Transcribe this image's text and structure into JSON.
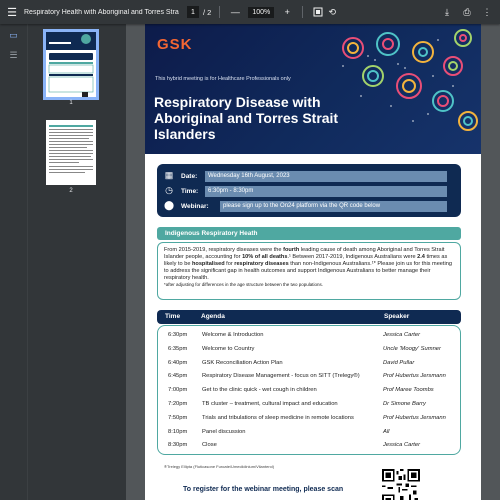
{
  "toolbar": {
    "title": "Respiratory Health with Aboriginal and Torres Strait Islan...",
    "page_current": "1",
    "page_total": "/ 2",
    "zoom_minus": "—",
    "zoom": "100%",
    "zoom_plus": "+",
    "icons": [
      "menu-icon",
      "fit-page-icon",
      "rotate-icon",
      "download-icon",
      "print-icon",
      "more-icon"
    ]
  },
  "sidebar": {
    "thumbnails": [
      {
        "label": "1"
      },
      {
        "label": "2"
      }
    ]
  },
  "document": {
    "logo": "GSK",
    "hcp_note": "This hybrid meeting is for Healthcare Professionals only",
    "title": "Respiratory Disease with Aboriginal and Torres Strait Islanders",
    "date_label": "Date:",
    "date_value": "Wednesday 16th August, 2023",
    "time_label": "Time:",
    "time_value": "6:30pm - 8:30pm",
    "webinar_label": "Webinar:",
    "webinar_value": "please sign up to the On24 platform via the QR code below",
    "section_heading": "Indigenous Respiratory Heath",
    "paragraph": {
      "p1": "From 2015-2019, respiratory diseases were the ",
      "b1": "fourth",
      "p2": " leading cause of death among Aboriginal and Torres Strait Islander people, accounting for ",
      "b2": "10% of all deaths",
      "p3": ".¹ Between 2017-2019, Indigenous Australians were ",
      "b3": "2.4",
      "p4": " times as likely to be ",
      "b4": "hospitalised",
      "p5": " for ",
      "b5": "respiratory diseases",
      "p6": " than non-Indigenous Australians.¹* Please join us for this meeting to address the significant gap in health outcomes and support Indigenous Australians to better manage their respiratory health.",
      "note": "*after adjusting for differences in the age structure between the two populations."
    },
    "agenda_headers": {
      "time": "Time",
      "agenda": "Agenda",
      "speaker": "Speaker"
    },
    "agenda": [
      {
        "time": "6:30pm",
        "item": "Welcome & Introduction",
        "speaker": "Jessica Carter"
      },
      {
        "time": "6:35pm",
        "item": "Welcome to Country",
        "speaker": "Uncle 'Moogy' Sumner"
      },
      {
        "time": "6:40pm",
        "item": "GSK Reconciliation Action Plan",
        "speaker": "David Pullar"
      },
      {
        "time": "6:45pm",
        "item": "Respiratory Disease Management - focus on SITT (Trelegy®)",
        "speaker": "Prof Hubertus Jersmann"
      },
      {
        "time": "7:00pm",
        "item": "Get to the clinic quick - wet cough in children",
        "speaker": "Prof Maree Toombs"
      },
      {
        "time": "7:20pm",
        "item": "TB cluster – treatment, cultural impact and education",
        "speaker": "Dr Simone Barry"
      },
      {
        "time": "7:50pm",
        "item": "Trials and tribulations of sleep medicine in remote locations",
        "speaker": "Prof Hubertus Jersmann"
      },
      {
        "time": "8:10pm",
        "item": "Panel discussion",
        "speaker": "All"
      },
      {
        "time": "8:30pm",
        "item": "Close",
        "speaker": "Jessica Carter"
      }
    ],
    "footnote": "®Trelegy Ellipta (Fluticasone Furoate/Umeclidinium/Vilanterol)",
    "register": "To register for the webinar meeting, please scan"
  },
  "colors": {
    "brand": "#f36633",
    "navy": "#0f2a52",
    "teal": "#4fa8a1",
    "viewer_bg": "#525659",
    "toolbar": "#323639"
  }
}
